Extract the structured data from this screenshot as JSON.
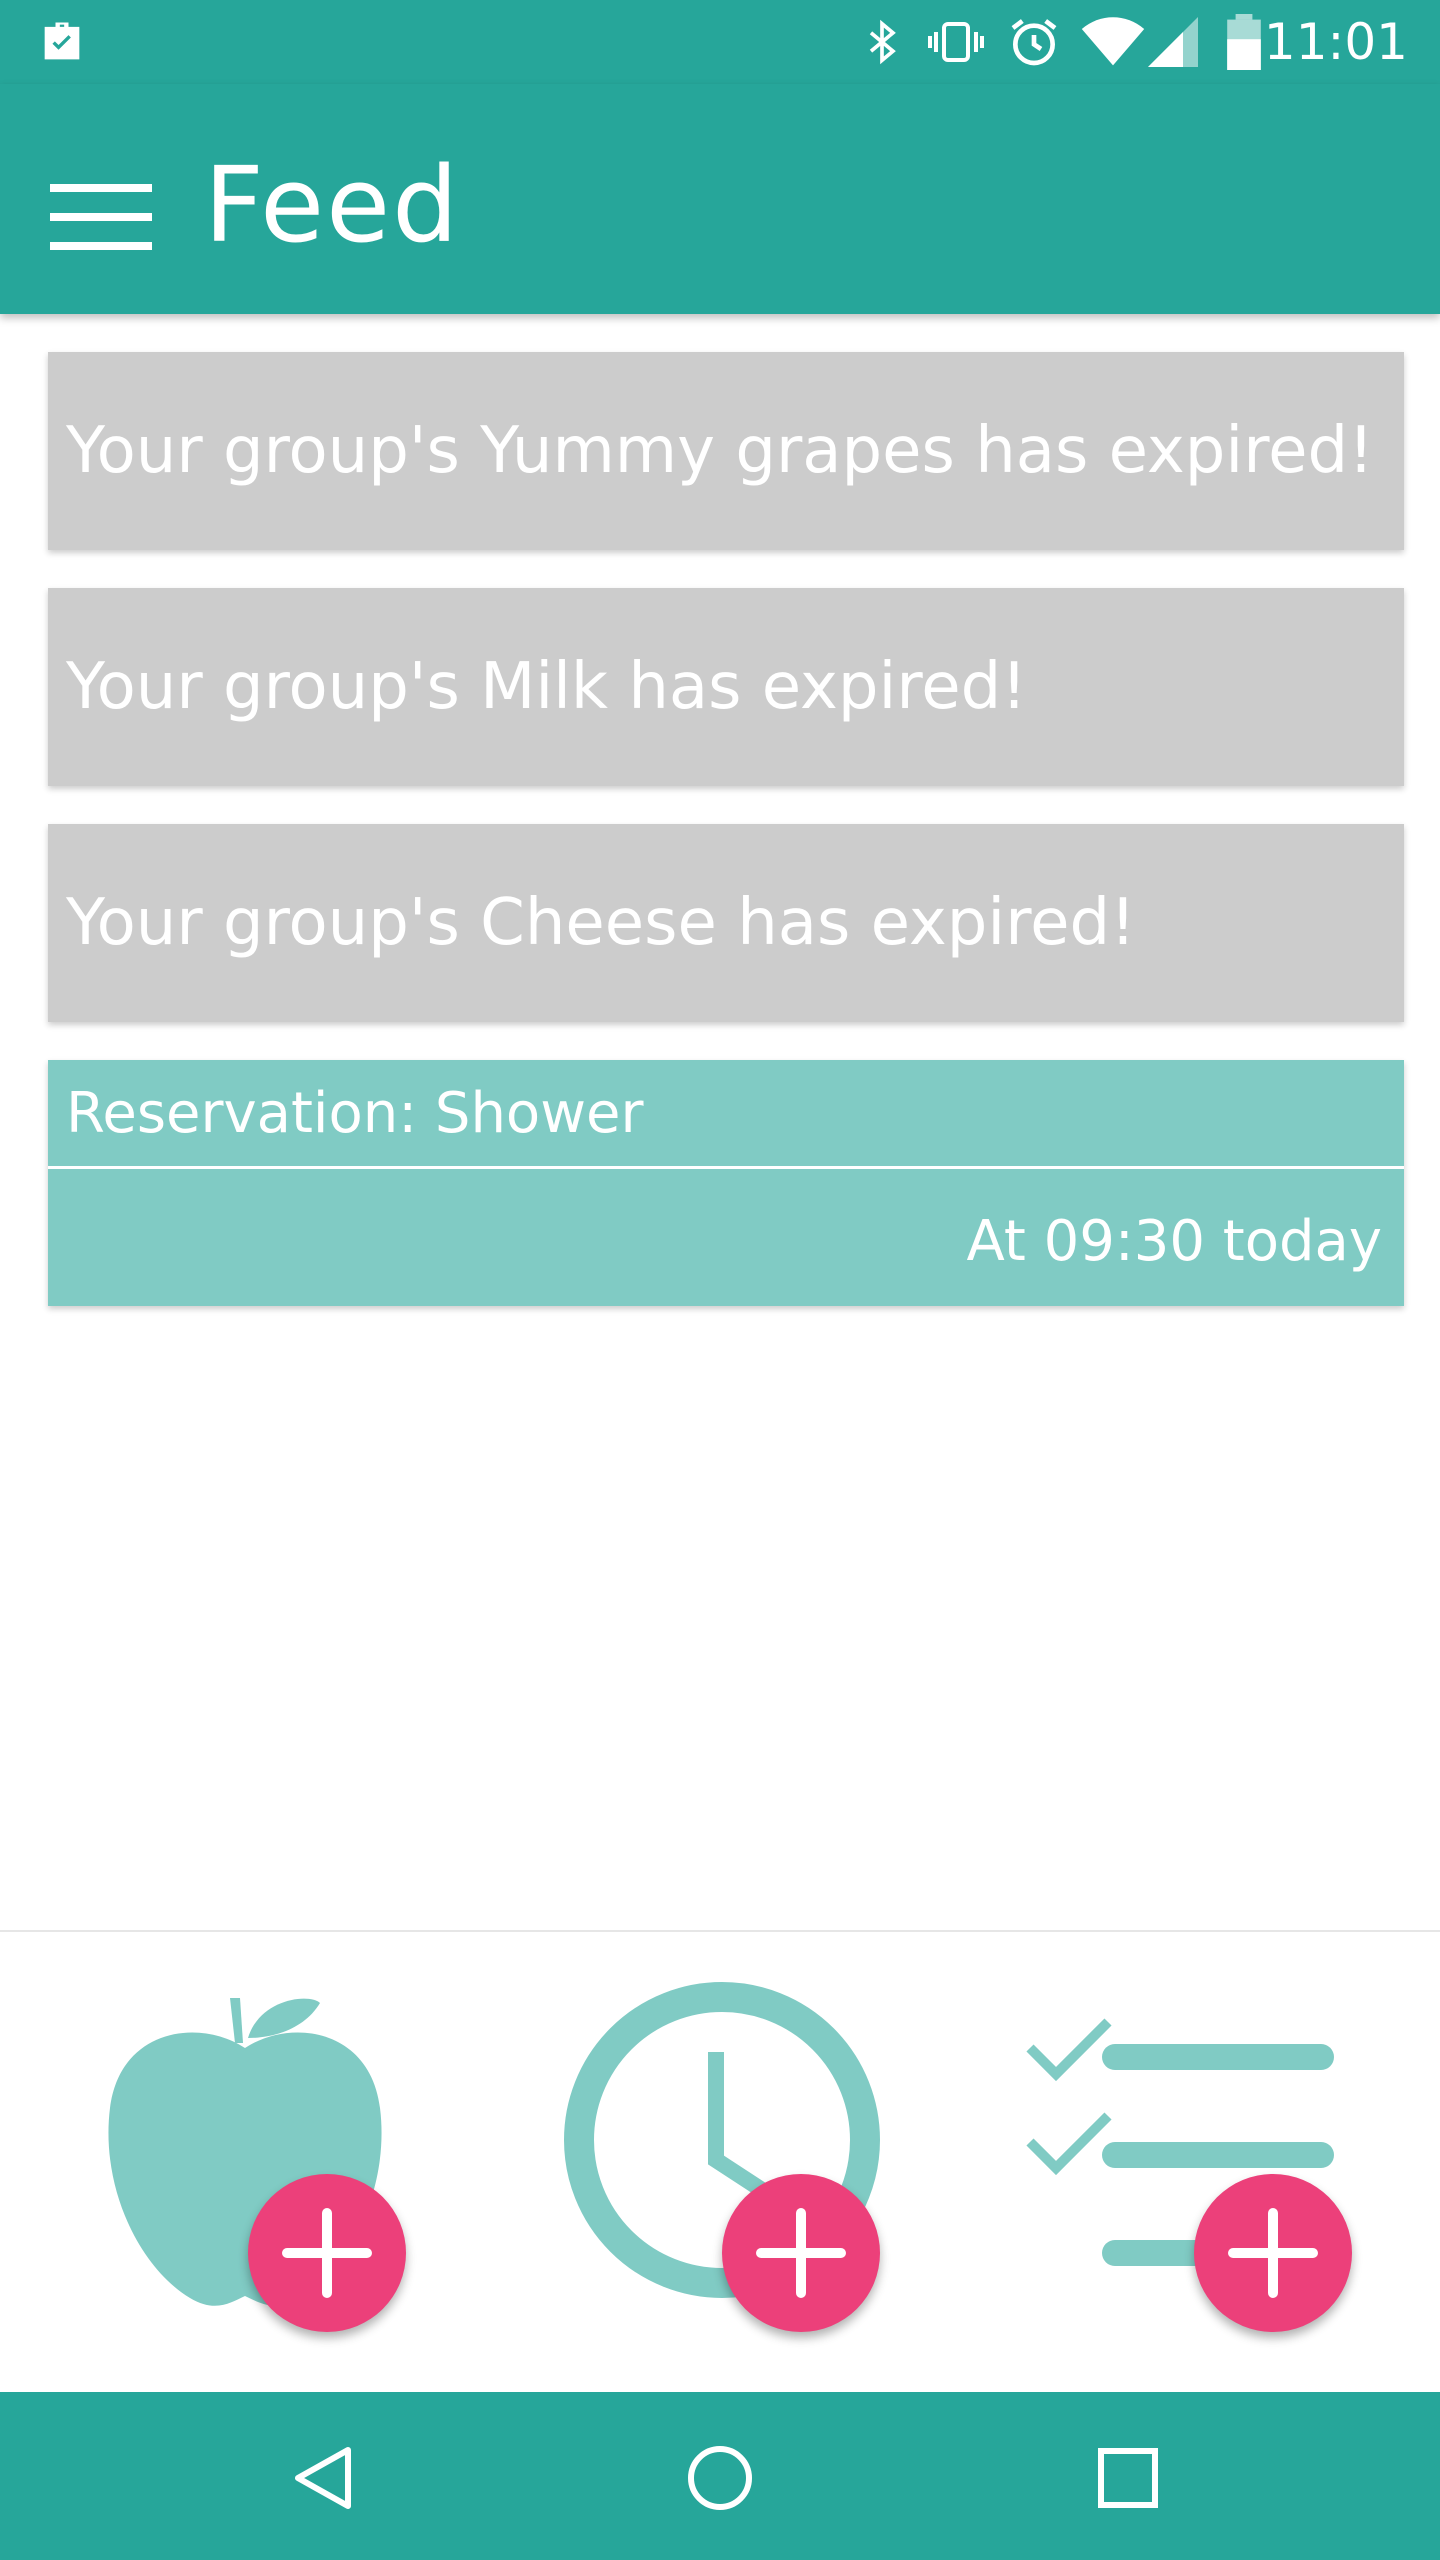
{
  "status_bar": {
    "time": "11:01",
    "icons": [
      "briefcase-check-icon",
      "bluetooth-icon",
      "vibrate-icon",
      "alarm-icon",
      "wifi-icon",
      "signal-icon",
      "battery-icon"
    ]
  },
  "app_bar": {
    "title": "Feed",
    "menu_icon": "hamburger-menu-icon"
  },
  "feed": {
    "expired_items": [
      {
        "text": "Your group's Yummy grapes has expired!"
      },
      {
        "text": "Your group's Milk has expired!"
      },
      {
        "text": "Your group's Cheese has expired!"
      }
    ],
    "reservation": {
      "title": "Reservation: Shower",
      "time": "At 09:30 today"
    }
  },
  "bottom_actions": [
    {
      "name": "add-food",
      "icon": "apple-icon"
    },
    {
      "name": "add-reservation",
      "icon": "clock-icon"
    },
    {
      "name": "add-task",
      "icon": "checklist-icon"
    }
  ],
  "nav_bar": {
    "buttons": [
      "back-icon",
      "home-icon",
      "recents-icon"
    ]
  },
  "colors": {
    "primary": "#26a69a",
    "primary_light": "#80cbc4",
    "card_gray": "#cccccc",
    "accent_pink": "#ec407a",
    "white": "#ffffff"
  }
}
